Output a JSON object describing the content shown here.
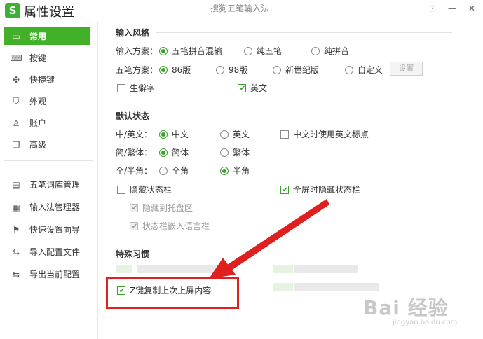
{
  "app": {
    "logo_text": "S",
    "title": "属性设置",
    "center_title": "搜狗五笔输入法",
    "controls": {
      "menu": "⊡",
      "minimize": "—",
      "close": "✕"
    }
  },
  "sidebar": {
    "items": [
      {
        "label": "常用",
        "icon": "monitor-icon",
        "active": true
      },
      {
        "label": "按键",
        "icon": "keyboard-icon"
      },
      {
        "label": "快捷键",
        "icon": "hotkey-icon"
      },
      {
        "label": "外观",
        "icon": "shirt-icon"
      },
      {
        "label": "账户",
        "icon": "user-icon"
      },
      {
        "label": "高级",
        "icon": "layers-icon"
      }
    ],
    "tools": [
      {
        "label": "五笔词库管理",
        "icon": "dictionary-icon"
      },
      {
        "label": "输入法管理器",
        "icon": "manager-icon"
      },
      {
        "label": "快速设置向导",
        "icon": "flag-icon"
      },
      {
        "label": "导入配置文件",
        "icon": "import-icon"
      },
      {
        "label": "导出当前配置",
        "icon": "export-icon"
      }
    ]
  },
  "input_style": {
    "title": "输入风格",
    "scheme_label": "输入方案：",
    "scheme_options": [
      "五笔拼音混输",
      "纯五笔",
      "纯拼音"
    ],
    "wubi_label": "五笔方案：",
    "wubi_options": [
      "86版",
      "98版",
      "新世纪版",
      "自定义"
    ],
    "settings_button": "设置",
    "rare_chars": "生僻字",
    "english": "英文"
  },
  "default_state": {
    "title": "默认状态",
    "cn_en_label": "中/英文：",
    "cn_en_options": [
      "中文",
      "英文"
    ],
    "cn_en_punct": "中文时使用英文标点",
    "simp_trad_label": "简/繁体：",
    "simp_trad_options": [
      "简体",
      "繁体"
    ],
    "width_label": "全/半角：",
    "width_options": [
      "全角",
      "半角"
    ],
    "hide_status_bar": "隐藏状态栏",
    "fullscreen_hide": "全屏时隐藏状态栏",
    "hide_to_tray": "隐藏到托盘区",
    "embed_lang_bar": "状态栏嵌入语言栏"
  },
  "special_habits": {
    "title": "特殊习惯",
    "z_key_copy": "Z键复制上次上屏内容"
  },
  "watermark": {
    "brand": "Bai 经验",
    "url": "jingyan.baidu.com"
  }
}
